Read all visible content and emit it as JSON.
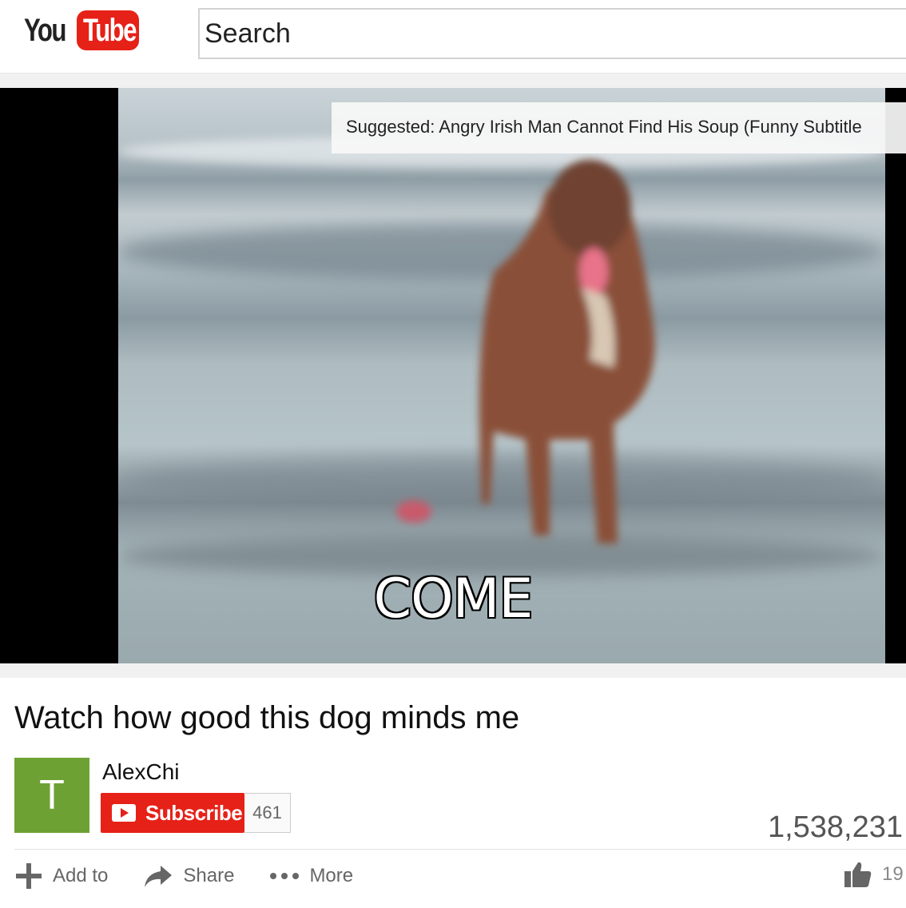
{
  "header": {
    "logo_you": "You",
    "logo_tube": "Tube",
    "search_placeholder": "Search"
  },
  "player": {
    "suggestion": "Suggested: Angry Irish Man Cannot Find His Soup (Funny Subtitle",
    "caption": "COME"
  },
  "video": {
    "title": "Watch how good this dog minds me",
    "channel": "AlexChi",
    "avatar_letter": "T",
    "subscribe_label": "Subscribe",
    "subscriber_count": "461",
    "views": "1,538,231"
  },
  "actions": {
    "add_to": "Add to",
    "share": "Share",
    "more": "More",
    "like_count": "19"
  },
  "colors": {
    "brand_red": "#e62117",
    "avatar_green": "#6ea134"
  },
  "icons": [
    "plus-icon",
    "share-arrow-icon",
    "more-dots-icon",
    "thumbs-up-icon",
    "play-icon"
  ]
}
